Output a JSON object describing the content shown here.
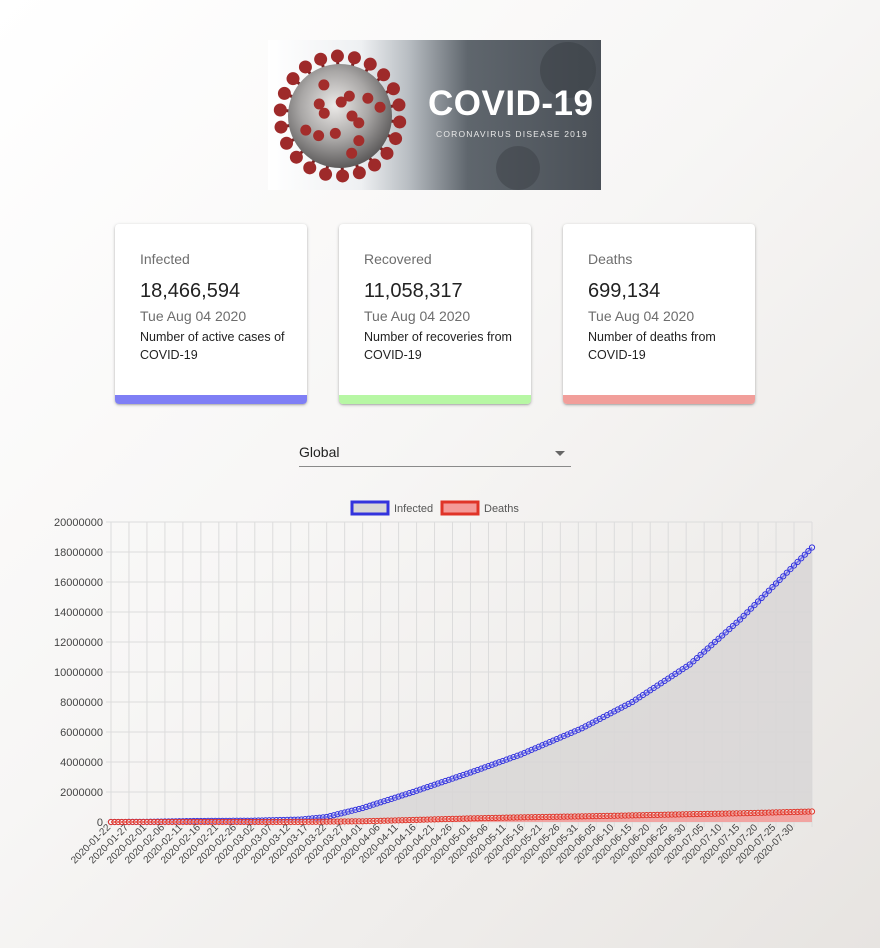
{
  "banner": {
    "title": "COVID-19",
    "subtitle": "CORONAVIRUS DISEASE 2019"
  },
  "cards": [
    {
      "title": "Infected",
      "value": "18,466,594",
      "date": "Tue Aug 04 2020",
      "description": "Number of active cases of COVID-19",
      "accent": "#7f7ff5"
    },
    {
      "title": "Recovered",
      "value": "11,058,317",
      "date": "Tue Aug 04 2020",
      "description": "Number of recoveries from COVID-19",
      "accent": "#b7f7a4"
    },
    {
      "title": "Deaths",
      "value": "699,134",
      "date": "Tue Aug 04 2020",
      "description": "Number of deaths from COVID-19",
      "accent": "#f19e9a"
    }
  ],
  "country_select": {
    "value": "Global"
  },
  "chart_data": {
    "type": "line",
    "x_start": "2020-01-22",
    "x_end": "2020-08-04",
    "x_tick_step_days": 5,
    "ylim": [
      0,
      20000000
    ],
    "y_ticks": [
      0,
      2000000,
      4000000,
      6000000,
      8000000,
      10000000,
      12000000,
      14000000,
      16000000,
      18000000,
      20000000
    ],
    "x_ticks": [
      "2020-01-22",
      "2020-01-27",
      "2020-02-01",
      "2020-02-06",
      "2020-02-11",
      "2020-02-16",
      "2020-02-21",
      "2020-02-26",
      "2020-03-02",
      "2020-03-07",
      "2020-03-12",
      "2020-03-17",
      "2020-03-22",
      "2020-03-27",
      "2020-04-01",
      "2020-04-06",
      "2020-04-11",
      "2020-04-16",
      "2020-04-21",
      "2020-04-26",
      "2020-05-01",
      "2020-05-06",
      "2020-05-11",
      "2020-05-16",
      "2020-05-21",
      "2020-05-26",
      "2020-05-31",
      "2020-06-05",
      "2020-06-10",
      "2020-06-15",
      "2020-06-20",
      "2020-06-25",
      "2020-06-30",
      "2020-07-05",
      "2020-07-10",
      "2020-07-15",
      "2020-07-20",
      "2020-07-25",
      "2020-07-30"
    ],
    "grid": true,
    "legend_position": "top",
    "series": [
      {
        "name": "Infected",
        "color": "#3333dd",
        "fill": "#d8d6d6",
        "key_points": [
          {
            "date": "2020-01-22",
            "value": 555
          },
          {
            "date": "2020-02-01",
            "value": 12000
          },
          {
            "date": "2020-02-15",
            "value": 69000
          },
          {
            "date": "2020-03-01",
            "value": 88000
          },
          {
            "date": "2020-03-15",
            "value": 167000
          },
          {
            "date": "2020-03-22",
            "value": 336000
          },
          {
            "date": "2020-04-01",
            "value": 930000
          },
          {
            "date": "2020-04-15",
            "value": 2000000
          },
          {
            "date": "2020-05-01",
            "value": 3300000
          },
          {
            "date": "2020-05-15",
            "value": 4500000
          },
          {
            "date": "2020-06-01",
            "value": 6250000
          },
          {
            "date": "2020-06-15",
            "value": 8000000
          },
          {
            "date": "2020-07-01",
            "value": 10500000
          },
          {
            "date": "2020-07-15",
            "value": 13500000
          },
          {
            "date": "2020-08-04",
            "value": 18300000
          }
        ]
      },
      {
        "name": "Deaths",
        "color": "#e03428",
        "fill": "#f49a98",
        "key_points": [
          {
            "date": "2020-01-22",
            "value": 17
          },
          {
            "date": "2020-02-15",
            "value": 1500
          },
          {
            "date": "2020-03-01",
            "value": 3000
          },
          {
            "date": "2020-03-15",
            "value": 6500
          },
          {
            "date": "2020-04-01",
            "value": 47000
          },
          {
            "date": "2020-04-15",
            "value": 135000
          },
          {
            "date": "2020-05-01",
            "value": 240000
          },
          {
            "date": "2020-05-15",
            "value": 310000
          },
          {
            "date": "2020-06-01",
            "value": 375000
          },
          {
            "date": "2020-06-15",
            "value": 440000
          },
          {
            "date": "2020-07-01",
            "value": 520000
          },
          {
            "date": "2020-07-15",
            "value": 580000
          },
          {
            "date": "2020-08-04",
            "value": 699000
          }
        ]
      }
    ]
  }
}
